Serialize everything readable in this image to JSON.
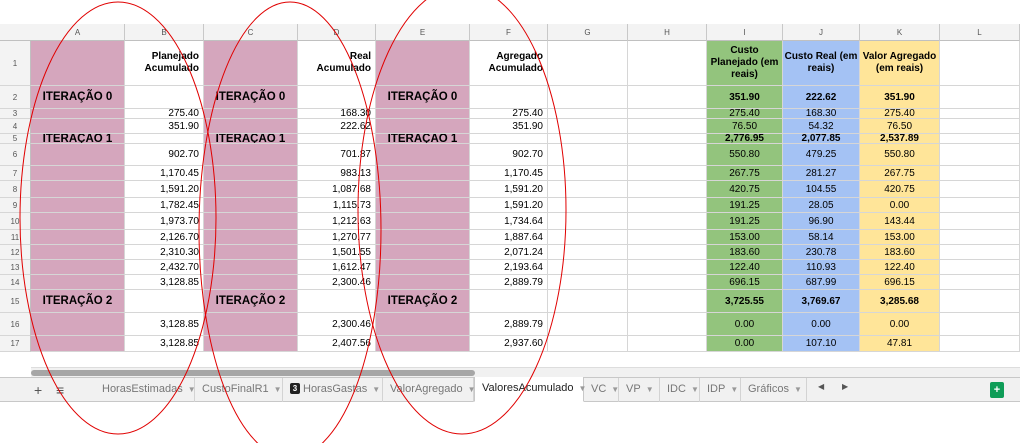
{
  "columns": [
    "A",
    "B",
    "C",
    "D",
    "E",
    "F",
    "G",
    "H",
    "I",
    "J",
    "K",
    "L"
  ],
  "header_row": {
    "row_number": "1",
    "b": "Planejado Acumulado",
    "d": "Real Acumulado",
    "f": "Agregado Acumulado",
    "i": "Custo Planejado (em reais)",
    "j": "Custo Real (em reais)",
    "k": "Valor Agregado (em reais)"
  },
  "rows": [
    {
      "n": "2",
      "a": "ITERAÇÃO 0",
      "b": "",
      "c": "ITERAÇÃO 0",
      "d": "",
      "e": "ITERAÇÃO 0",
      "f": "",
      "i": "351.90",
      "j": "222.62",
      "k": "351.90",
      "bold": true
    },
    {
      "n": "3",
      "a": "",
      "b": "275.40",
      "c": "",
      "d": "168.30",
      "e": "",
      "f": "275.40",
      "i": "275.40",
      "j": "168.30",
      "k": "275.40",
      "bold": false
    },
    {
      "n": "4",
      "a": "",
      "b": "351.90",
      "c": "",
      "d": "222.62",
      "e": "",
      "f": "351.90",
      "i": "76.50",
      "j": "54.32",
      "k": "76.50",
      "bold": false
    },
    {
      "n": "5",
      "a": "ITERAÇÃO 1",
      "b": "",
      "c": "ITERAÇÃO 1",
      "d": "",
      "e": "ITERAÇÃO 1",
      "f": "",
      "i": "2,776.95",
      "j": "2,077.85",
      "k": "2,537.89",
      "bold": true
    },
    {
      "n": "6",
      "a": "",
      "b": "902.70",
      "c": "",
      "d": "701.87",
      "e": "",
      "f": "902.70",
      "i": "550.80",
      "j": "479.25",
      "k": "550.80",
      "bold": false
    },
    {
      "n": "7",
      "a": "",
      "b": "1,170.45",
      "c": "",
      "d": "983.13",
      "e": "",
      "f": "1,170.45",
      "i": "267.75",
      "j": "281.27",
      "k": "267.75",
      "bold": false
    },
    {
      "n": "8",
      "a": "",
      "b": "1,591.20",
      "c": "",
      "d": "1,087.68",
      "e": "",
      "f": "1,591.20",
      "i": "420.75",
      "j": "104.55",
      "k": "420.75",
      "bold": false
    },
    {
      "n": "9",
      "a": "",
      "b": "1,782.45",
      "c": "",
      "d": "1,115.73",
      "e": "",
      "f": "1,591.20",
      "i": "191.25",
      "j": "28.05",
      "k": "0.00",
      "bold": false
    },
    {
      "n": "10",
      "a": "",
      "b": "1,973.70",
      "c": "",
      "d": "1,212.63",
      "e": "",
      "f": "1,734.64",
      "i": "191.25",
      "j": "96.90",
      "k": "143.44",
      "bold": false
    },
    {
      "n": "11",
      "a": "",
      "b": "2,126.70",
      "c": "",
      "d": "1,270.77",
      "e": "",
      "f": "1,887.64",
      "i": "153.00",
      "j": "58.14",
      "k": "153.00",
      "bold": false
    },
    {
      "n": "12",
      "a": "",
      "b": "2,310.30",
      "c": "",
      "d": "1,501.55",
      "e": "",
      "f": "2,071.24",
      "i": "183.60",
      "j": "230.78",
      "k": "183.60",
      "bold": false
    },
    {
      "n": "13",
      "a": "",
      "b": "2,432.70",
      "c": "",
      "d": "1,612.47",
      "e": "",
      "f": "2,193.64",
      "i": "122.40",
      "j": "110.93",
      "k": "122.40",
      "bold": false
    },
    {
      "n": "14",
      "a": "",
      "b": "3,128.85",
      "c": "",
      "d": "2,300.46",
      "e": "",
      "f": "2,889.79",
      "i": "696.15",
      "j": "687.99",
      "k": "696.15",
      "bold": false
    },
    {
      "n": "15",
      "a": "ITERAÇÃO 2",
      "b": "",
      "c": "ITERAÇÃO 2",
      "d": "",
      "e": "ITERAÇÃO 2",
      "f": "",
      "i": "3,725.55",
      "j": "3,769.67",
      "k": "3,285.68",
      "bold": true
    },
    {
      "n": "16",
      "a": "",
      "b": "3,128.85",
      "c": "",
      "d": "2,300.46",
      "e": "",
      "f": "2,889.79",
      "i": "0.00",
      "j": "0.00",
      "k": "0.00",
      "bold": false
    },
    {
      "n": "17",
      "a": "",
      "b": "3,128.85",
      "c": "",
      "d": "2,407.56",
      "e": "",
      "f": "2,937.60",
      "i": "0.00",
      "j": "107.10",
      "k": "47.81",
      "bold": false
    }
  ],
  "tabs": [
    {
      "label": "HorasEstimadas",
      "active": false,
      "badge": ""
    },
    {
      "label": "CustoFinalR1",
      "active": false,
      "badge": ""
    },
    {
      "label": "HorasGastas",
      "active": false,
      "badge": "3"
    },
    {
      "label": "ValorAgregado",
      "active": false,
      "badge": ""
    },
    {
      "label": "ValoresAcumulado",
      "active": true,
      "badge": ""
    },
    {
      "label": "VC",
      "active": false,
      "badge": ""
    },
    {
      "label": "VP",
      "active": false,
      "badge": ""
    },
    {
      "label": "IDC",
      "active": false,
      "badge": ""
    },
    {
      "label": "IDP",
      "active": false,
      "badge": ""
    },
    {
      "label": "Gráficos",
      "active": false,
      "badge": ""
    }
  ],
  "toolbar": {
    "add_symbol": "+",
    "list_symbol": "≡",
    "prev_symbol": "◀",
    "next_symbol": "▶",
    "addon_symbol": "+"
  },
  "colors": {
    "pink": "#d5a6bd",
    "green": "#93c47d",
    "blue": "#a4c2f4",
    "yellow": "#ffe599",
    "annotation": "#e00000"
  }
}
